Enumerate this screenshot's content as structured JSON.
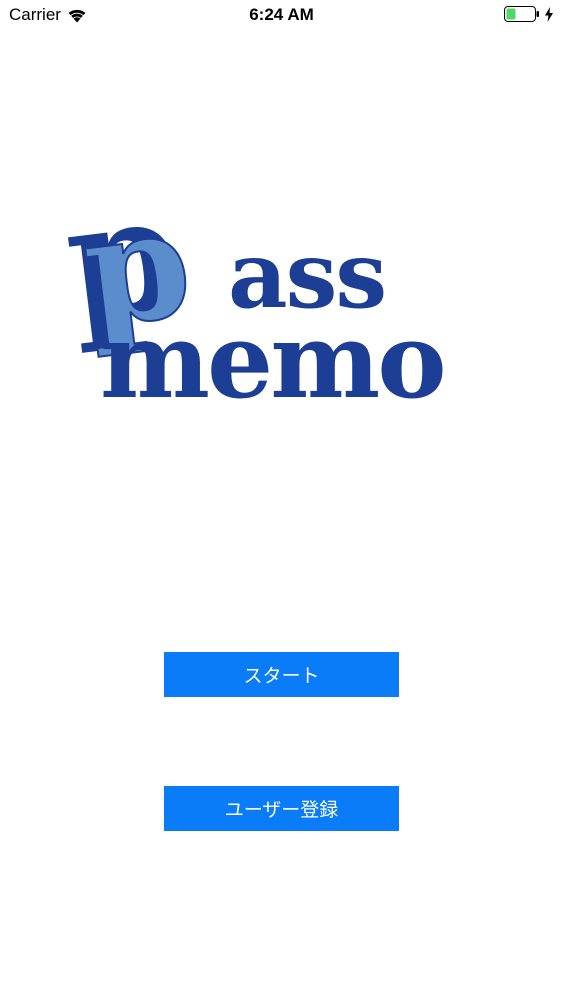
{
  "status_bar": {
    "carrier": "Carrier",
    "time": "6:24 AM",
    "battery_color": "#4cd964"
  },
  "logo": {
    "text_line1": "pass",
    "text_line2": "memo",
    "dark_color": "#1c3e94",
    "light_color": "#5b8ccc"
  },
  "buttons": {
    "start_label": "スタート",
    "register_label": "ユーザー登録",
    "color": "#0a7cf8"
  }
}
